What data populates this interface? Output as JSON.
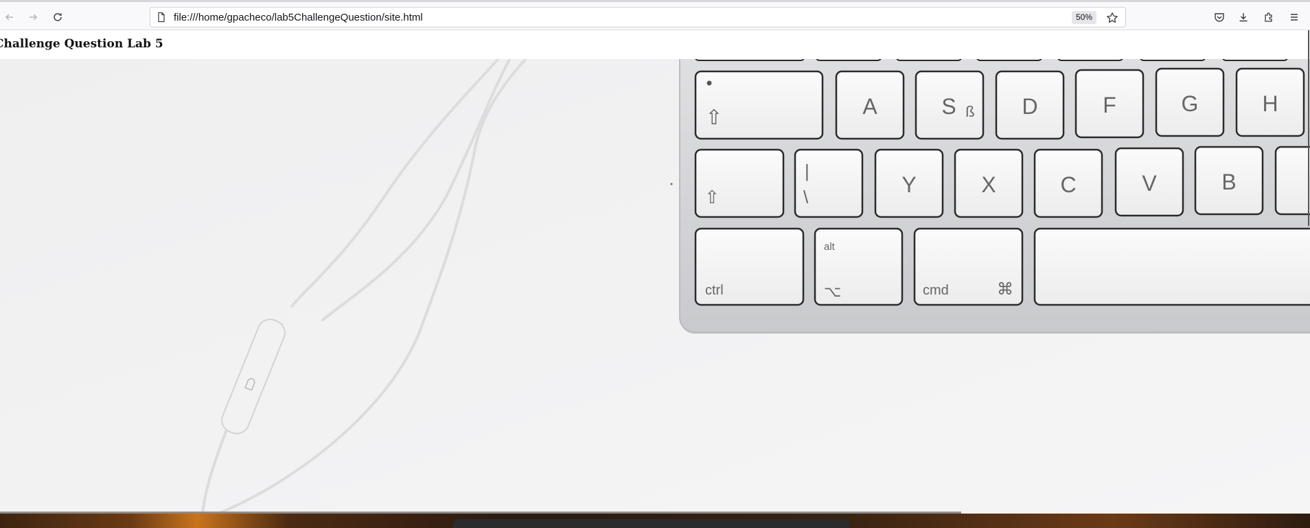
{
  "browser": {
    "url": "file:///home/gpacheco/lab5ChallengeQuestion/site.html",
    "zoom": "50%",
    "nav_icons": [
      "back-arrow-icon",
      "forward-arrow-icon",
      "reload-icon"
    ],
    "toolbar_icons": [
      "pocket-icon",
      "download-icon",
      "extensions-icon",
      "menu-icon"
    ]
  },
  "page": {
    "title": "Challenge Question Lab 5"
  },
  "photo": {
    "keys_row1": [
      "A",
      "S",
      "ß",
      "D",
      "F",
      "G",
      "H"
    ],
    "keys_row2": [
      "|",
      "\\",
      "Y",
      "X",
      "C",
      "V",
      "B"
    ],
    "keys_row3": [
      "ctrl",
      "alt",
      "⌥",
      "cmd",
      "⌘"
    ],
    "shift_glyph": "⇧"
  }
}
